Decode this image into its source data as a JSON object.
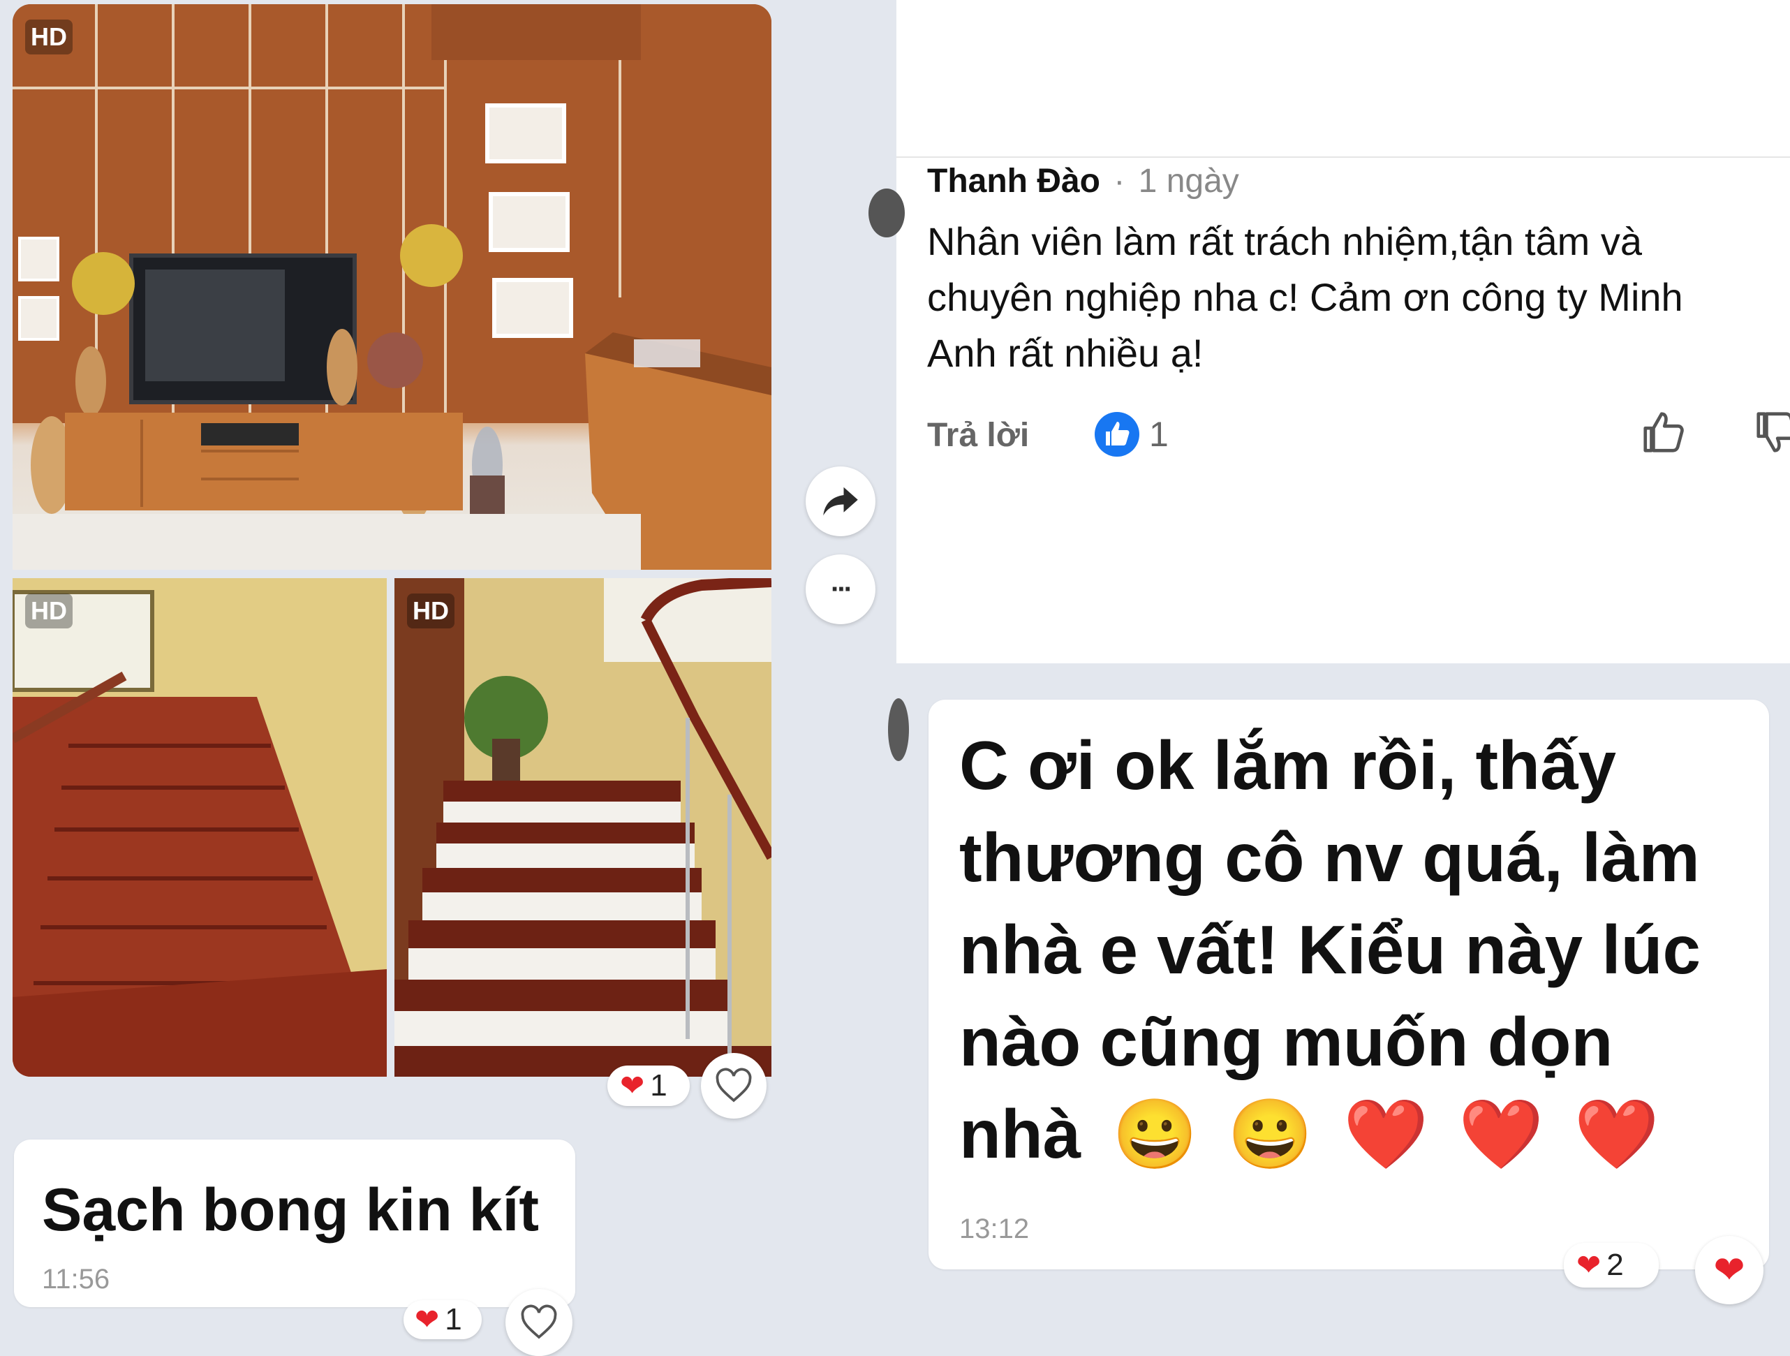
{
  "media": {
    "hd_label": "HD",
    "reaction": {
      "icon": "heart-icon",
      "count": "1"
    }
  },
  "actions": {
    "share_icon": "share-arrow-icon",
    "more_icon": "more-dots-icon",
    "more_label": "···"
  },
  "message_left": {
    "text": "Sạch bong kin kít",
    "time": "11:56",
    "reaction_count": "1"
  },
  "comment": {
    "author": "Thanh Đào",
    "separator": "·",
    "age": "1 ngày",
    "text_lines": [
      "Nhân viên làm rất trách nhiệm,tận tâm và",
      "chuyên nghiệp nha c! Cảm ơn công ty Minh",
      "Anh rất nhiều ạ!"
    ],
    "reply_label": "Trả lời",
    "like_count": "1"
  },
  "message_right": {
    "lines": [
      "C ơi ok lắm rồi,  thấy",
      "thương cô nv quá, làm",
      "nhà e vất! Kiểu này lúc",
      "nào cũng muốn dọn",
      "nhà"
    ],
    "emojis": [
      "😀",
      "😀",
      "❤️",
      "❤️",
      "❤️"
    ],
    "time": "13:12",
    "reaction_count": "2"
  },
  "colors": {
    "background": "#e3e7ee",
    "heart": "#e8232c",
    "like_blue": "#1877f2",
    "time_gray": "#999999"
  }
}
